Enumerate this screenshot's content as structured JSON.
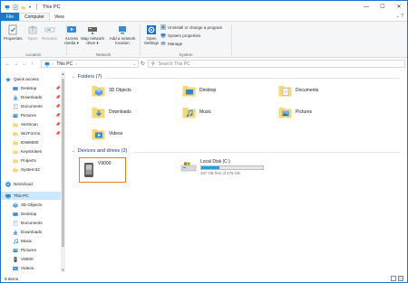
{
  "window": {
    "title": "This PC",
    "controls": {
      "minimize": "—",
      "maximize": "☐",
      "close": "✕"
    }
  },
  "ribbon_tabs": [
    "File",
    "Computer",
    "View"
  ],
  "ribbon": {
    "location_group": {
      "label": "Location",
      "properties": "Properties",
      "open": "Open",
      "rename": "Rename"
    },
    "network_group": {
      "label": "Network",
      "access_media": "Access media ▾",
      "map_network_drive": "Map network drive ▾",
      "add_network_location": "Add a network location"
    },
    "system_group": {
      "label": "System",
      "open_settings": "Open Settings",
      "uninstall": "Uninstall or change a program",
      "system_properties": "System properties",
      "manage": "Manage"
    }
  },
  "address": {
    "path": "This PC",
    "search_placeholder": "Search This PC"
  },
  "nav": {
    "quick_access": {
      "label": "Quick access",
      "items": [
        {
          "label": "Desktop",
          "pinned": true,
          "icon": "desktop-icon"
        },
        {
          "label": "Downloads",
          "pinned": true,
          "icon": "downloads-icon"
        },
        {
          "label": "Documents",
          "pinned": true,
          "icon": "documents-icon"
        },
        {
          "label": "Pictures",
          "pinned": true,
          "icon": "pictures-icon"
        },
        {
          "label": "VeriScan",
          "pinned": true,
          "icon": "folder-icon"
        },
        {
          "label": "WizForms",
          "pinned": true,
          "icon": "folder-icon"
        },
        {
          "label": "IDW9000",
          "pinned": false,
          "icon": "folder-icon"
        },
        {
          "label": "Keystrokes",
          "pinned": false,
          "icon": "folder-icon"
        },
        {
          "label": "Projects",
          "pinned": false,
          "icon": "folder-icon"
        },
        {
          "label": "System32",
          "pinned": false,
          "icon": "folder-icon"
        }
      ]
    },
    "nextcloud": "Nextcloud",
    "this_pc": {
      "label": "This PC",
      "items": [
        {
          "label": "3D Objects",
          "icon": "3d-objects-icon"
        },
        {
          "label": "Desktop",
          "icon": "desktop-icon"
        },
        {
          "label": "Documents",
          "icon": "documents-icon"
        },
        {
          "label": "Downloads",
          "icon": "downloads-icon"
        },
        {
          "label": "Music",
          "icon": "music-icon"
        },
        {
          "label": "Pictures",
          "icon": "pictures-icon"
        },
        {
          "label": "V9000",
          "icon": "device-icon"
        },
        {
          "label": "Videos",
          "icon": "videos-icon"
        }
      ]
    }
  },
  "content": {
    "folders_header": "Folders (7)",
    "folders": [
      {
        "label": "3D Objects",
        "icon": "3d-objects-icon"
      },
      {
        "label": "Desktop",
        "icon": "desktop-icon"
      },
      {
        "label": "Documents",
        "icon": "documents-icon"
      },
      {
        "label": "Downloads",
        "icon": "downloads-icon"
      },
      {
        "label": "Music",
        "icon": "music-icon"
      },
      {
        "label": "Pictures",
        "icon": "pictures-icon"
      },
      {
        "label": "Videos",
        "icon": "videos-icon"
      }
    ],
    "devices_header": "Devices and drives (2)",
    "devices": [
      {
        "label": "V9000",
        "icon": "portable-device-icon",
        "selected": true
      },
      {
        "label": "Local Disk (C:)",
        "icon": "hard-drive-icon",
        "free_text": "337 GB free of 476 GB",
        "used_fraction": 0.29
      }
    ]
  },
  "status": {
    "items": "9 items"
  },
  "colors": {
    "accent": "#1979ca",
    "selection": "#cce8ff",
    "highlight_border": "#f07b1e",
    "folder": "#f8d775"
  }
}
